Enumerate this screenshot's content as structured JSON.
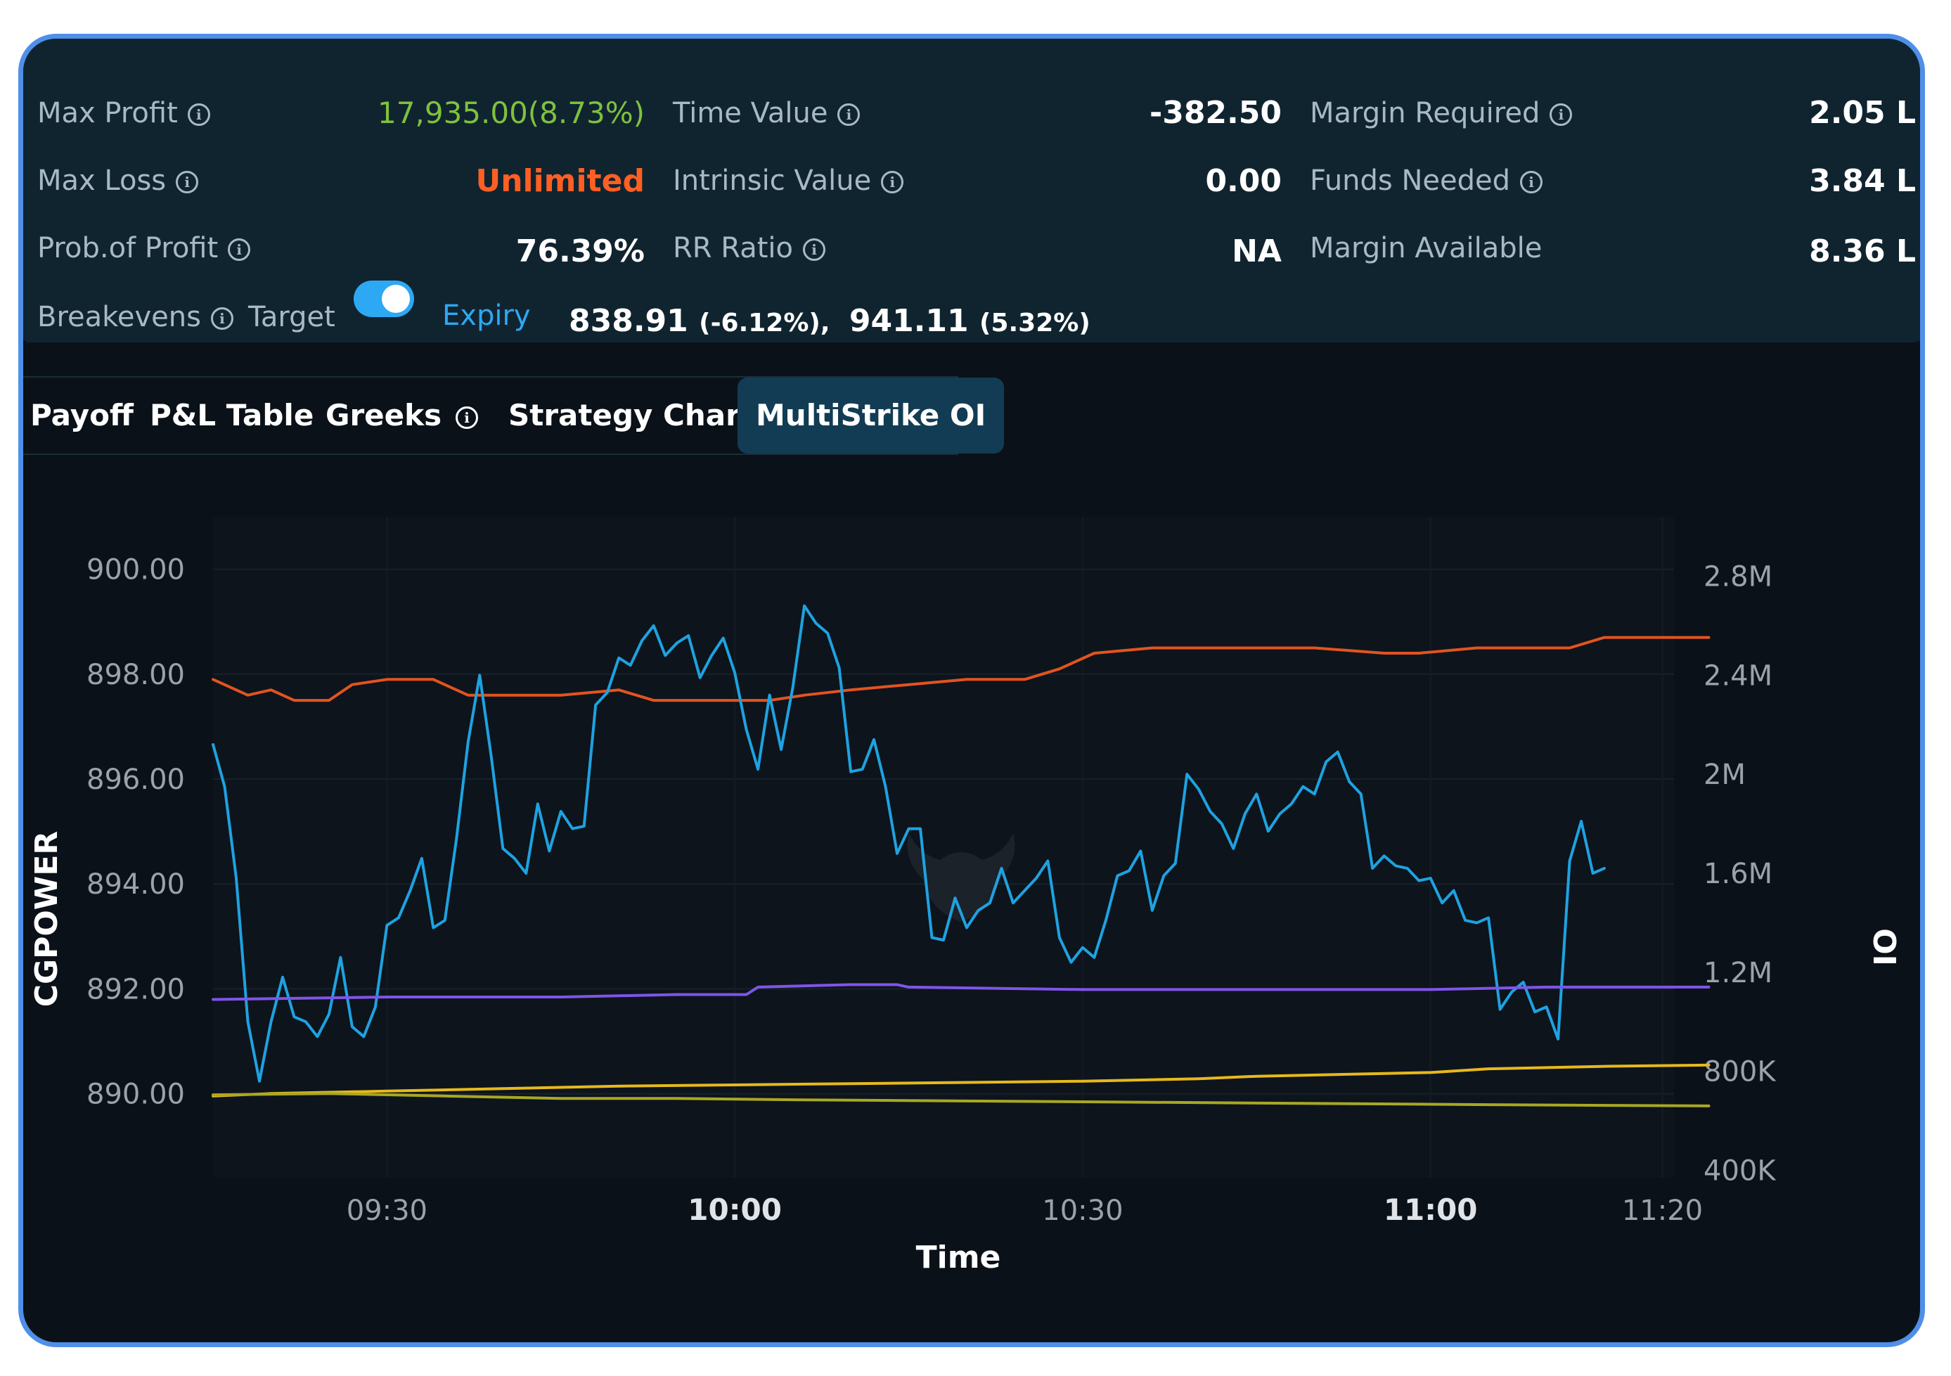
{
  "summary": {
    "max_profit": {
      "label": "Max Profit",
      "value": "17,935.00(8.73%)"
    },
    "max_loss": {
      "label": "Max Loss",
      "value": "Unlimited"
    },
    "prob_profit": {
      "label": "Prob.of Profit",
      "value": "76.39%"
    },
    "time_value": {
      "label": "Time Value",
      "value": "-382.50"
    },
    "intrinsic_value": {
      "label": "Intrinsic Value",
      "value": "0.00"
    },
    "rr_ratio": {
      "label": "RR Ratio",
      "value": "NA"
    },
    "margin_required": {
      "label": "Margin Required",
      "value": "2.05 L"
    },
    "funds_needed": {
      "label": "Funds Needed",
      "value": "3.84 L"
    },
    "margin_available": {
      "label": "Margin Available",
      "value": "8.36 L"
    },
    "breakevens": {
      "label": "Breakevens",
      "target_label": "Target",
      "expiry_label": "Expiry",
      "toggle_on": true,
      "be1": "838.91",
      "be1_pct": "(-6.12%),",
      "be2": "941.11",
      "be2_pct": "(5.32%)"
    }
  },
  "tabs": [
    {
      "label": "Payoff"
    },
    {
      "label": "P&L Table"
    },
    {
      "label": "Greeks"
    },
    {
      "label": "Strategy Charts"
    },
    {
      "label": "MultiStrike OI",
      "active": true
    }
  ],
  "colors": {
    "price": "#e3531f",
    "oi_blue": "#1ea2e0",
    "oi_purple": "#7f55e8",
    "oi_gold": "#e6b91c",
    "oi_olive": "#a8a824",
    "profit_green": "#7fc13d",
    "loss_orange": "#ff5f23",
    "accent": "#2da8f3"
  },
  "chart_data": {
    "type": "line",
    "xlabel": "Time",
    "ylabel": "CGPOWER",
    "y2label": "OI",
    "x_ticks": [
      "09:30",
      "10:00",
      "10:30",
      "11:00",
      "11:20"
    ],
    "x_ticks_bold": [
      "10:00",
      "11:00"
    ],
    "y_ticks": [
      "900.00",
      "898.00",
      "896.00",
      "894.00",
      "892.00",
      "890.00"
    ],
    "y2_ticks": [
      "2.8M",
      "2.4M",
      "2M",
      "1.6M",
      "1.2M",
      "800K",
      "400K"
    ],
    "ylim": [
      888.4,
      901.0
    ],
    "y2lim": [
      370000,
      3040000
    ],
    "x_minutes": [
      9.25,
      11.35
    ],
    "series": [
      {
        "color_key": "price",
        "axis": "left",
        "points": [
          [
            "09:15",
            897.9
          ],
          [
            "09:18",
            897.6
          ],
          [
            "09:20",
            897.7
          ],
          [
            "09:22",
            897.5
          ],
          [
            "09:25",
            897.5
          ],
          [
            "09:27",
            897.8
          ],
          [
            "09:30",
            897.9
          ],
          [
            "09:34",
            897.9
          ],
          [
            "09:37",
            897.6
          ],
          [
            "09:40",
            897.6
          ],
          [
            "09:45",
            897.6
          ],
          [
            "09:50",
            897.7
          ],
          [
            "09:53",
            897.5
          ],
          [
            "09:57",
            897.5
          ],
          [
            "10:00",
            897.5
          ],
          [
            "10:03",
            897.5
          ],
          [
            "10:06",
            897.6
          ],
          [
            "10:10",
            897.7
          ],
          [
            "10:15",
            897.8
          ],
          [
            "10:20",
            897.9
          ],
          [
            "10:25",
            897.9
          ],
          [
            "10:28",
            898.1
          ],
          [
            "10:31",
            898.4
          ],
          [
            "10:36",
            898.5
          ],
          [
            "10:43",
            898.5
          ],
          [
            "10:50",
            898.5
          ],
          [
            "10:56",
            898.4
          ],
          [
            "10:59",
            898.4
          ],
          [
            "11:04",
            898.5
          ],
          [
            "11:12",
            898.5
          ],
          [
            "11:15",
            898.7
          ],
          [
            "11:24",
            898.7
          ]
        ]
      },
      {
        "color_key": "oi_blue",
        "axis": "right",
        "points": [
          [
            "09:15",
            2120000
          ],
          [
            "09:16",
            1950000
          ],
          [
            "09:17",
            1580000
          ],
          [
            "09:18",
            1000000
          ],
          [
            "09:19",
            760000
          ],
          [
            "09:20",
            1000000
          ],
          [
            "09:21",
            1180000
          ],
          [
            "09:22",
            1020000
          ],
          [
            "09:23",
            1000000
          ],
          [
            "09:24",
            940000
          ],
          [
            "09:25",
            1030000
          ],
          [
            "09:26",
            1260000
          ],
          [
            "09:27",
            980000
          ],
          [
            "09:28",
            940000
          ],
          [
            "09:29",
            1060000
          ],
          [
            "09:30",
            1390000
          ],
          [
            "09:31",
            1420000
          ],
          [
            "09:32",
            1530000
          ],
          [
            "09:33",
            1660000
          ],
          [
            "09:34",
            1380000
          ],
          [
            "09:35",
            1410000
          ],
          [
            "09:36",
            1740000
          ],
          [
            "09:37",
            2130000
          ],
          [
            "09:38",
            2400000
          ],
          [
            "09:39",
            2070000
          ],
          [
            "09:40",
            1700000
          ],
          [
            "09:41",
            1660000
          ],
          [
            "09:42",
            1600000
          ],
          [
            "09:43",
            1880000
          ],
          [
            "09:44",
            1690000
          ],
          [
            "09:45",
            1850000
          ],
          [
            "09:46",
            1780000
          ],
          [
            "09:47",
            1790000
          ],
          [
            "09:48",
            2280000
          ],
          [
            "09:49",
            2330000
          ],
          [
            "09:50",
            2470000
          ],
          [
            "09:51",
            2440000
          ],
          [
            "09:52",
            2540000
          ],
          [
            "09:53",
            2600000
          ],
          [
            "09:54",
            2480000
          ],
          [
            "09:55",
            2530000
          ],
          [
            "09:56",
            2560000
          ],
          [
            "09:57",
            2390000
          ],
          [
            "09:58",
            2480000
          ],
          [
            "09:59",
            2550000
          ],
          [
            "10:00",
            2410000
          ],
          [
            "10:01",
            2180000
          ],
          [
            "10:02",
            2020000
          ],
          [
            "10:03",
            2320000
          ],
          [
            "10:04",
            2100000
          ],
          [
            "10:05",
            2350000
          ],
          [
            "10:06",
            2680000
          ],
          [
            "10:07",
            2610000
          ],
          [
            "10:08",
            2570000
          ],
          [
            "10:09",
            2430000
          ],
          [
            "10:10",
            2010000
          ],
          [
            "10:11",
            2020000
          ],
          [
            "10:12",
            2140000
          ],
          [
            "10:13",
            1950000
          ],
          [
            "10:14",
            1680000
          ],
          [
            "10:15",
            1780000
          ],
          [
            "10:16",
            1780000
          ],
          [
            "10:17",
            1340000
          ],
          [
            "10:18",
            1330000
          ],
          [
            "10:19",
            1500000
          ],
          [
            "10:20",
            1380000
          ],
          [
            "10:21",
            1450000
          ],
          [
            "10:22",
            1480000
          ],
          [
            "10:23",
            1620000
          ],
          [
            "10:24",
            1480000
          ],
          [
            "10:25",
            1530000
          ],
          [
            "10:26",
            1580000
          ],
          [
            "10:27",
            1650000
          ],
          [
            "10:28",
            1340000
          ],
          [
            "10:29",
            1240000
          ],
          [
            "10:30",
            1300000
          ],
          [
            "10:31",
            1260000
          ],
          [
            "10:32",
            1410000
          ],
          [
            "10:33",
            1590000
          ],
          [
            "10:34",
            1610000
          ],
          [
            "10:35",
            1690000
          ],
          [
            "10:36",
            1450000
          ],
          [
            "10:37",
            1590000
          ],
          [
            "10:38",
            1640000
          ],
          [
            "10:39",
            2000000
          ],
          [
            "10:40",
            1940000
          ],
          [
            "10:41",
            1850000
          ],
          [
            "10:42",
            1800000
          ],
          [
            "10:43",
            1700000
          ],
          [
            "10:44",
            1840000
          ],
          [
            "10:45",
            1920000
          ],
          [
            "10:46",
            1770000
          ],
          [
            "10:47",
            1840000
          ],
          [
            "10:48",
            1880000
          ],
          [
            "10:49",
            1950000
          ],
          [
            "10:50",
            1920000
          ],
          [
            "10:51",
            2050000
          ],
          [
            "10:52",
            2090000
          ],
          [
            "10:53",
            1970000
          ],
          [
            "10:54",
            1920000
          ],
          [
            "10:55",
            1620000
          ],
          [
            "10:56",
            1670000
          ],
          [
            "10:57",
            1630000
          ],
          [
            "10:58",
            1620000
          ],
          [
            "10:59",
            1570000
          ],
          [
            "11:00",
            1580000
          ],
          [
            "11:01",
            1480000
          ],
          [
            "11:02",
            1530000
          ],
          [
            "11:03",
            1410000
          ],
          [
            "11:04",
            1400000
          ],
          [
            "11:05",
            1420000
          ],
          [
            "11:06",
            1050000
          ],
          [
            "11:07",
            1120000
          ],
          [
            "11:08",
            1160000
          ],
          [
            "11:09",
            1040000
          ],
          [
            "11:10",
            1060000
          ],
          [
            "11:11",
            930000
          ],
          [
            "11:12",
            1650000
          ],
          [
            "11:13",
            1810000
          ],
          [
            "11:14",
            1600000
          ],
          [
            "11:15",
            1620000
          ]
        ]
      },
      {
        "color_key": "oi_purple",
        "axis": "right",
        "points": [
          [
            "09:15",
            1090000
          ],
          [
            "09:30",
            1100000
          ],
          [
            "09:45",
            1100000
          ],
          [
            "09:55",
            1110000
          ],
          [
            "10:01",
            1110000
          ],
          [
            "10:02",
            1140000
          ],
          [
            "10:10",
            1150000
          ],
          [
            "10:14",
            1150000
          ],
          [
            "10:15",
            1140000
          ],
          [
            "10:30",
            1130000
          ],
          [
            "10:45",
            1130000
          ],
          [
            "11:00",
            1130000
          ],
          [
            "11:10",
            1140000
          ],
          [
            "11:24",
            1140000
          ]
        ]
      },
      {
        "color_key": "oi_gold",
        "axis": "right",
        "points": [
          [
            "09:15",
            700000
          ],
          [
            "09:20",
            710000
          ],
          [
            "09:30",
            720000
          ],
          [
            "09:40",
            730000
          ],
          [
            "09:50",
            740000
          ],
          [
            "10:00",
            745000
          ],
          [
            "10:10",
            750000
          ],
          [
            "10:20",
            755000
          ],
          [
            "10:30",
            760000
          ],
          [
            "10:40",
            770000
          ],
          [
            "10:45",
            780000
          ],
          [
            "10:55",
            790000
          ],
          [
            "11:00",
            795000
          ],
          [
            "11:05",
            810000
          ],
          [
            "11:15",
            820000
          ],
          [
            "11:24",
            825000
          ]
        ]
      },
      {
        "color_key": "oi_olive",
        "axis": "right",
        "points": [
          [
            "09:15",
            705000
          ],
          [
            "09:25",
            710000
          ],
          [
            "09:35",
            700000
          ],
          [
            "09:45",
            690000
          ],
          [
            "09:55",
            690000
          ],
          [
            "10:05",
            685000
          ],
          [
            "10:20",
            680000
          ],
          [
            "10:35",
            675000
          ],
          [
            "10:50",
            670000
          ],
          [
            "11:05",
            665000
          ],
          [
            "11:24",
            660000
          ]
        ]
      }
    ]
  }
}
